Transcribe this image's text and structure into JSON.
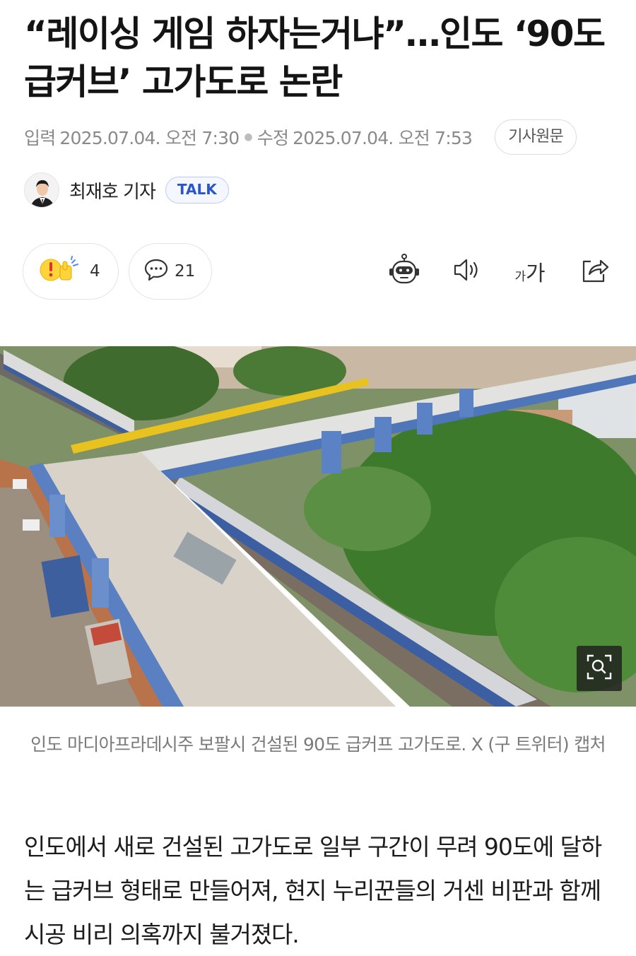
{
  "article": {
    "headline": "“레이싱 게임 하자는거냐”…인도 ‘90도 급커브’ 고가도로 논란",
    "published_label": "입력",
    "published_time": "2025.07.04. 오전 7:30",
    "modified_label": "수정",
    "modified_time": "2025.07.04. 오전 7:53",
    "source_button": "기사원문",
    "reporter": "최재호 기자",
    "talk_label": "TALK"
  },
  "actions": {
    "reaction_count": "4",
    "comment_count": "21",
    "font_size_small": "가",
    "font_size_large": "가",
    "icons": [
      "reaction-icon",
      "comment-icon",
      "ai-bot-icon",
      "audio-icon",
      "font-size-icon",
      "share-icon"
    ]
  },
  "photo": {
    "caption": "인도 마디아프라데시주 보팔시 건설된 90도 급커프 고가도로. X (구 트위터) 캡처",
    "zoom_icon": "zoom-icon"
  },
  "body": {
    "paragraph": "인도에서 새로 건설된 고가도로 일부 구간이 무려 90도에 달하는 급커브 형태로 만들어져, 현지 누리꾼들의 거센 비판과 함께 시공 비리 의혹까지 불거졌다."
  },
  "colors": {
    "talk_accent": "#2b56c6",
    "meta_text": "#8a8a8a",
    "caption_text": "#7a7a7a"
  }
}
